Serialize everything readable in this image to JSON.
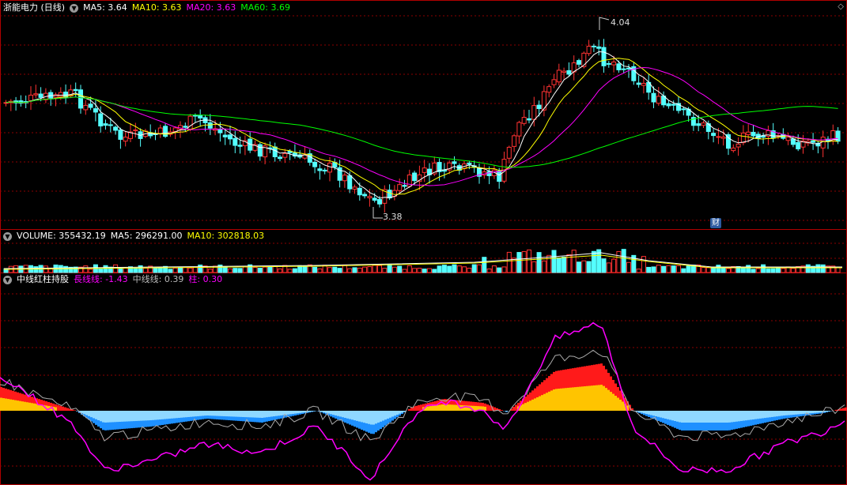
{
  "stock": {
    "title": "浙能电力 (日线)",
    "ma5_label": "MA5: 3.64",
    "ma10_label": "MA10: 3.63",
    "ma20_label": "MA20: 3.63",
    "ma60_label": "MA60: 3.69",
    "high_marker": "4.04",
    "low_marker": "3.38",
    "badge": "财"
  },
  "volume": {
    "label": "VOLUME: 355432.19",
    "ma5_label": "MA5: 296291.00",
    "ma10_label": "MA10: 302818.03"
  },
  "indicator": {
    "name": "中线红柱持股",
    "long_label": "長线线: -1.43",
    "mid_label": "中线线: 0.39",
    "bar_label": "柱: 0.30"
  },
  "colors": {
    "up": "#ff3232",
    "down": "#54ffff",
    "ma5": "#ffffff",
    "ma10": "#ffff00",
    "ma20": "#ff00ff",
    "ma60": "#00ff00",
    "grid": "#8b0000",
    "frame": "#b00000"
  },
  "icons": {
    "collapse": "circle-chevron-icon",
    "corner": "diamond-icon"
  }
}
